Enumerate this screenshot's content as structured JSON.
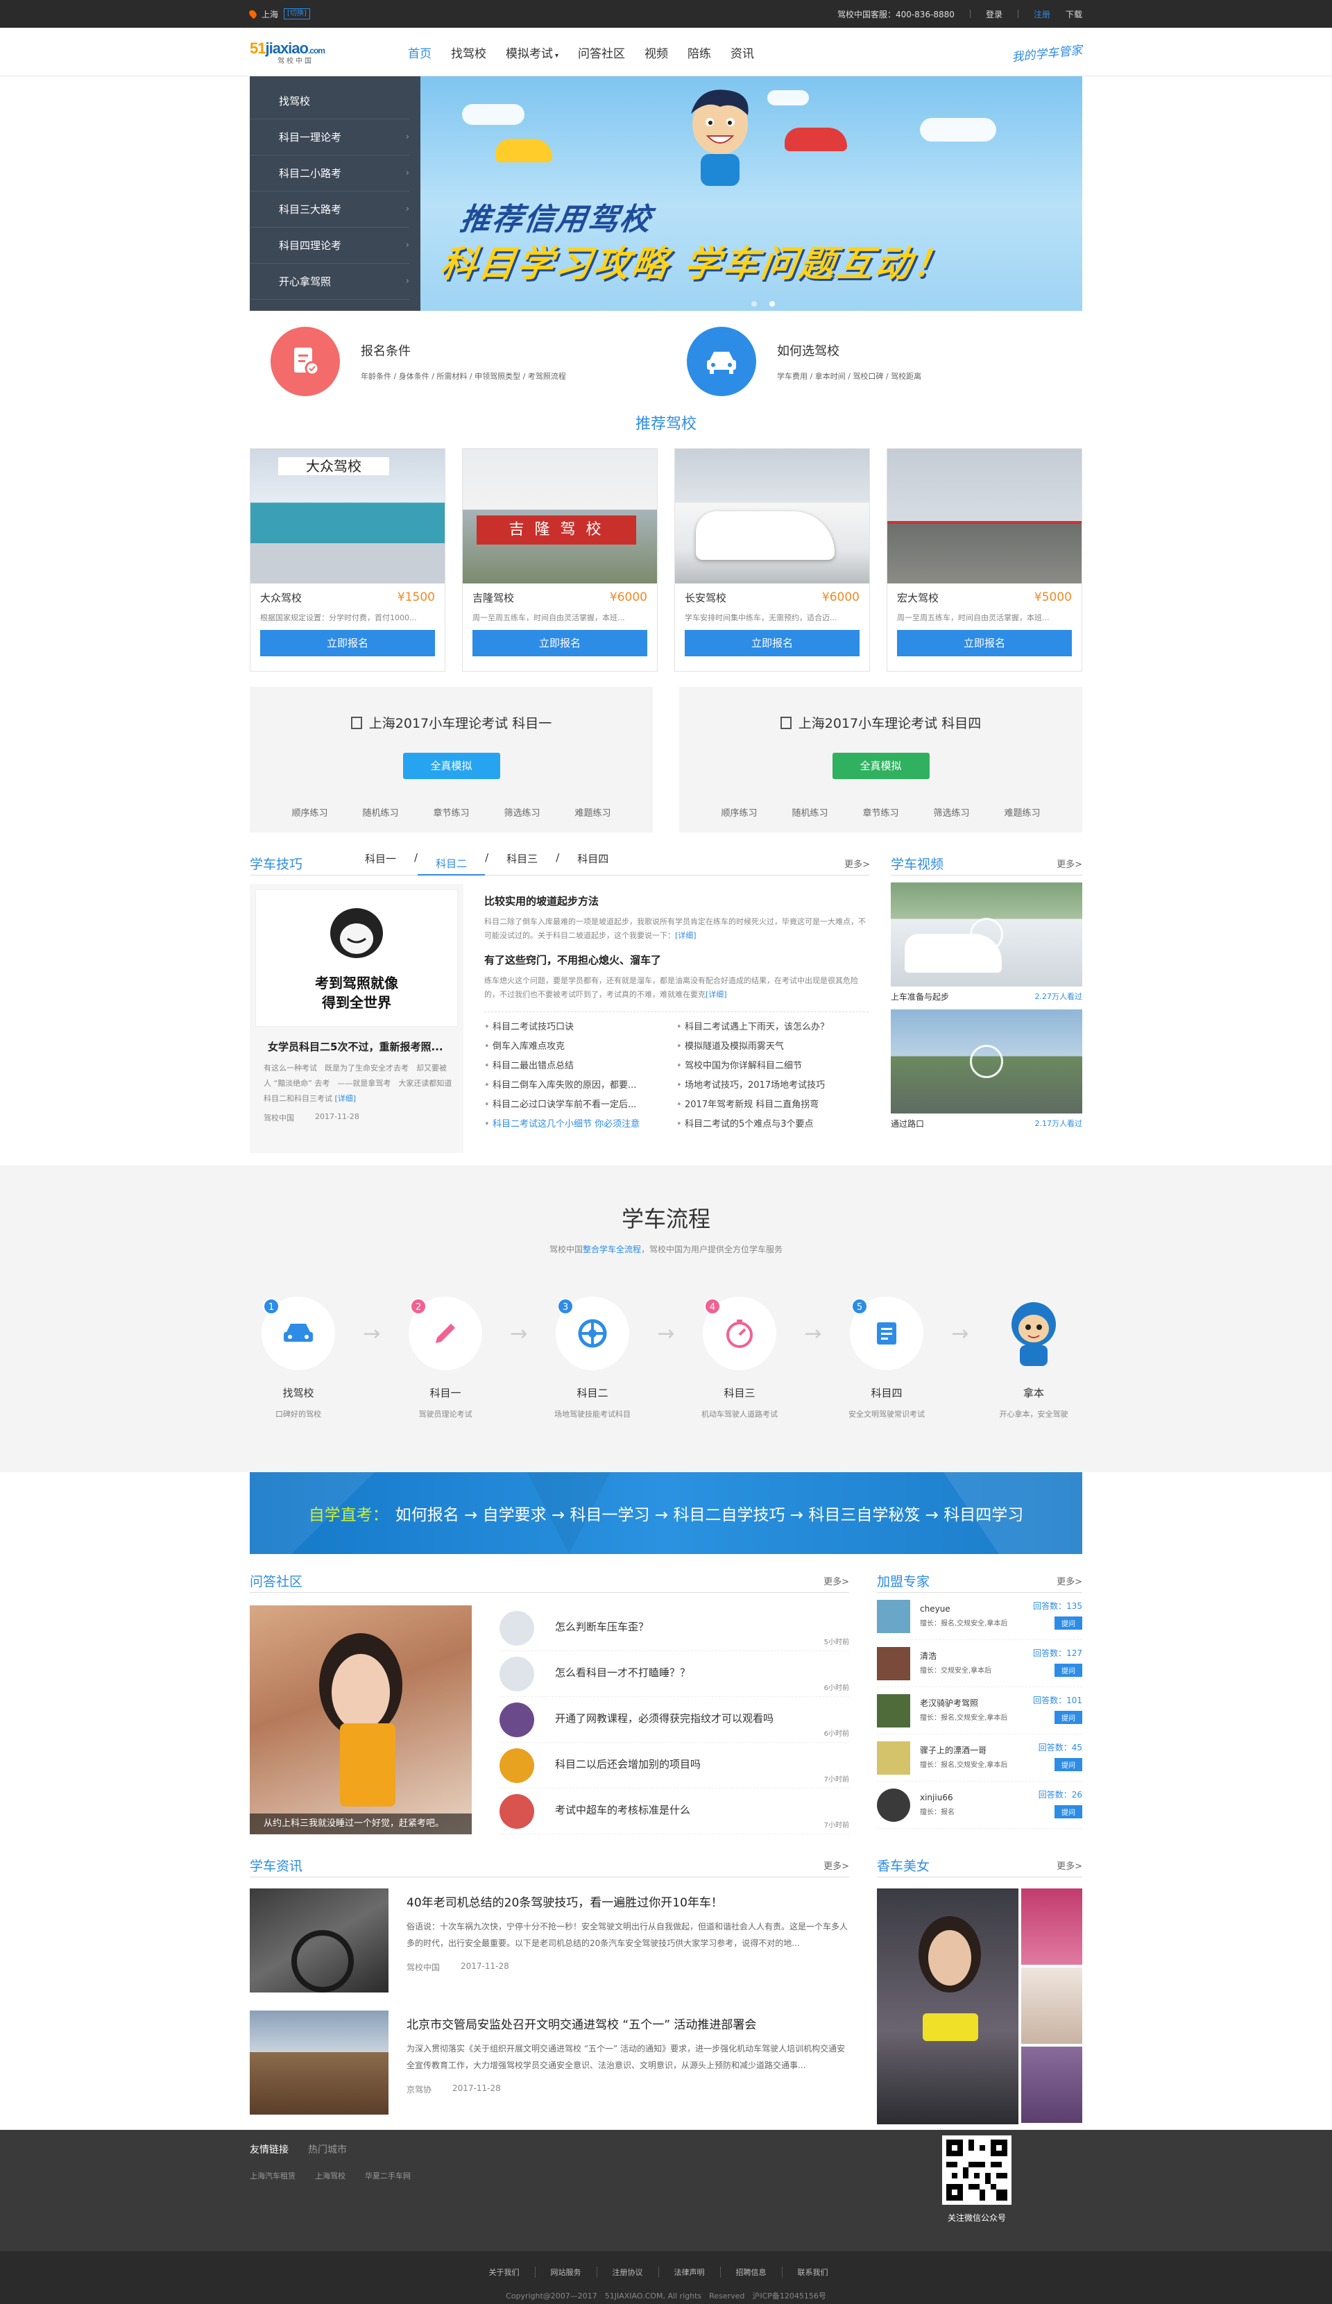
{
  "topbar": {
    "city": "上海",
    "switch": "[切换]",
    "hotline": "驾校中国客服：400-836-8880",
    "login": "登录",
    "register": "注册",
    "download": "下载"
  },
  "header": {
    "logo_main": "jiaxiao",
    "logo_prefix": "51",
    "logo_suffix": ".com",
    "logo_sub": "驾校中国",
    "slogan": "我的学车管家",
    "nav": [
      "首页",
      "找驾校",
      "模拟考试",
      "问答社区",
      "视频",
      "陪练",
      "资讯"
    ]
  },
  "side_menu": [
    "找驾校",
    "科目一理论考",
    "科目二小路考",
    "科目三大路考",
    "科目四理论考",
    "开心拿驾照"
  ],
  "banner": {
    "line1": "推荐信用驾校",
    "line2": "科目学习攻略 学车问题互动！"
  },
  "features": [
    {
      "title": "报名条件",
      "sub": "年龄条件 / 身体条件 / 所需材料 / 申领驾照类型 / 考驾照流程"
    },
    {
      "title": "如何选驾校",
      "sub": "学车费用 / 拿本时间 / 驾校口碑 / 驾校距离"
    }
  ],
  "recommend_title": "推荐驾校",
  "schools": [
    {
      "name": "大众驾校",
      "price": "¥1500",
      "desc": "根据国家规定设置：分学时付费，首付1000...",
      "sign": "立即报名",
      "sign_label": "大众驾校"
    },
    {
      "name": "吉隆驾校",
      "price": "¥6000",
      "desc": "周一至周五练车，时间自由灵活掌握，本班...",
      "sign": "立即报名",
      "sign_label": "吉 隆 驾 校"
    },
    {
      "name": "长安驾校",
      "price": "¥6000",
      "desc": "学车安排时间集中练车，无需预约，适合迈...",
      "sign": "立即报名"
    },
    {
      "name": "宏大驾校",
      "price": "¥5000",
      "desc": "周一至周五练车，时间自由灵活掌握，本班...",
      "sign": "立即报名"
    }
  ],
  "exams": [
    {
      "title": "上海2017小车理论考试 科目一",
      "btn": "全真模拟",
      "color": "#27a4f0",
      "links": [
        "顺序练习",
        "随机练习",
        "章节练习",
        "筛选练习",
        "难题练习"
      ]
    },
    {
      "title": "上海2017小车理论考试 科目四",
      "btn": "全真模拟",
      "color": "#2fb160",
      "links": [
        "顺序练习",
        "随机练习",
        "章节练习",
        "筛选练习",
        "难题练习"
      ]
    }
  ],
  "tips": {
    "title": "学车技巧",
    "more": "更多>",
    "tabs": [
      "科目一",
      "科目二",
      "科目三",
      "科目四"
    ],
    "card": {
      "img_text1": "考到驾照就像",
      "img_text2": "得到全世界",
      "title": "女学员科目二5次不过，重新报考照...",
      "desc": "有这么一种考试　既是为了生命安全才去考　却又要被人 “黯淡绝命” 去考　——就是拿驾考　大家还读都知道　科目二和科目三考试",
      "detail": "[详细]",
      "source": "驾校中国",
      "date": "2017-11-28"
    },
    "arts": [
      {
        "title": "比较实用的坡道起步方法",
        "desc": "科目二除了倒车入库最难的一项是坡道起步，我歌说所有学员肯定在练车的时候死火过，毕竟这可是一大难点，不可能没试过的。关于科目二坡道起步，这个我要说一下：",
        "detail": "[详细]"
      },
      {
        "title": "有了这些窍门，不用担心熄火、溜车了",
        "desc": "练车熄火这个问题，要是学员都有，还有就是溜车，都是油离没有配合好造成的结果，在考试中出现是很其危险的，不过我们也不要被考试吓到了，考试真的不难，难就难在要克",
        "detail": "[详细]"
      }
    ],
    "list": [
      "科目二考试技巧口诀",
      "科目二考试遇上下雨天，该怎么办？",
      "倒车入库难点攻克",
      "模拟隧道及模拟雨雾天气",
      "科目二最出错点总结",
      "驾校中国为你详解科目二细节",
      "科目二倒车入库失败的原因，都要...",
      "场地考试技巧，2017场地考试技巧",
      "科目二必过口诀学车前不看一定后...",
      "2017年驾考新规 科目二直角拐弯",
      "科目二考试这几个小细节 你必须注意",
      "科目二考试的5个难点与3个要点"
    ]
  },
  "videos": {
    "title": "学车视频",
    "more": "更多>",
    "items": [
      {
        "cap": "上车准备与起步",
        "views": "2.27万人看过"
      },
      {
        "cap": "通过路口",
        "views": "2.17万人看过"
      }
    ]
  },
  "process": {
    "title": "学车流程",
    "sub_pre": "驾校中国",
    "sub_hl": "整合学车全流程",
    "sub_post": "，驾校中国为用户提供全方位学车服务",
    "steps": [
      {
        "n": "1",
        "label": "找驾校",
        "desc": "口碑好的驾校",
        "color": "#2d8ce6"
      },
      {
        "n": "2",
        "label": "科目一",
        "desc": "驾驶员理论考试",
        "color": "#f06292"
      },
      {
        "n": "3",
        "label": "科目二",
        "desc": "场地驾驶技能考试科目",
        "color": "#2d8ce6"
      },
      {
        "n": "4",
        "label": "科目三",
        "desc": "机动车驾驶人道路考试",
        "color": "#f06292"
      },
      {
        "n": "5",
        "label": "科目四",
        "desc": "安全文明驾驶常识考试",
        "color": "#2d8ce6"
      },
      {
        "n": "",
        "label": "拿本",
        "desc": "开心拿本，安全驾驶",
        "color": ""
      }
    ]
  },
  "study": {
    "label": "自学直考：",
    "text": "如何报名 → 自学要求 → 科目一学习 → 科目二自学技巧 → 科目三自学秘笈 → 科目四学习"
  },
  "qa": {
    "title": "问答社区",
    "more": "更多>",
    "img_cap": "从约上科三我就没睡过一个好觉，赶紧考吧。",
    "items": [
      {
        "q": "怎么判断车压车歪？",
        "t": "5小时前"
      },
      {
        "q": "怎么看科目一才不打瞌睡？？",
        "t": "6小时前"
      },
      {
        "q": "开通了网教课程，必须得获完指纹才可以观看吗",
        "t": "6小时前"
      },
      {
        "q": "科目二以后还会增加别的项目吗",
        "t": "7小时前"
      },
      {
        "q": "考试中超车的考核标准是什么",
        "t": "7小时前"
      }
    ]
  },
  "experts": {
    "title": "加盟专家",
    "more": "更多>",
    "items": [
      {
        "name": "cheyue",
        "ans": "回答数：135",
        "spec": "擅长：报名,交规安全,拿本后",
        "ask": "提问"
      },
      {
        "name": "清浩",
        "ans": "回答数：127",
        "spec": "擅长：交规安全,拿本后",
        "ask": "提问"
      },
      {
        "name": "老汉骑驴考驾照",
        "ans": "回答数：101",
        "spec": "擅长：报名,交规安全,拿本后",
        "ask": "提问"
      },
      {
        "name": "骤子上的漂酒一哥",
        "ans": "回答数：45",
        "spec": "擅长：报名,交规安全,拿本后",
        "ask": "提问"
      },
      {
        "name": "xinjiu66",
        "ans": "回答数：26",
        "spec": "擅长：报名",
        "ask": "提问"
      }
    ]
  },
  "news": {
    "title": "学车资讯",
    "more": "更多>",
    "items": [
      {
        "title": "40年老司机总结的20条驾驶技巧，看一遍胜过你开10年车！",
        "desc": "俗语说：十次车祸九次快，宁停十分不抢一秒！安全驾驶文明出行从自我做起，但道和谐社会人人有责。这是一个车多人多的时代，出行安全最重要。以下是老司机总结的20条汽车安全驾驶技巧供大家学习参考，说得不对的地...",
        "src": "驾校中国",
        "date": "2017-11-28"
      },
      {
        "title": "北京市交管局安监处召开文明交通进驾校 “五个一” 活动推进部署会",
        "desc": "为深入贯彻落实《关于组织开展文明交通进驾校 “五个一” 活动的通知》要求，进一步强化机动车驾驶人培训机构交通安全宣传教育工作，大力增强驾校学员交通安全意识、法治意识、文明意识，从源头上预防和减少道路交通事...",
        "src": "京驾协",
        "date": "2017-11-28"
      }
    ]
  },
  "beauty": {
    "title": "香车美女",
    "more": "更多>"
  },
  "footer": {
    "links_tab1": "友情链接",
    "links_tab2": "热门城市",
    "links": [
      "上海汽车租赁",
      "上海驾校",
      "华夏二手车网"
    ],
    "qr_cap": "关注微信公众号",
    "bottom_links": [
      "关于我们",
      "网站服务",
      "注册协议",
      "法律声明",
      "招聘信息",
      "联系我们"
    ],
    "copyright": "Copyright@2007—2017　51JIAXIAO.COM, All rights　Reserved　沪ICP备12045156号"
  }
}
